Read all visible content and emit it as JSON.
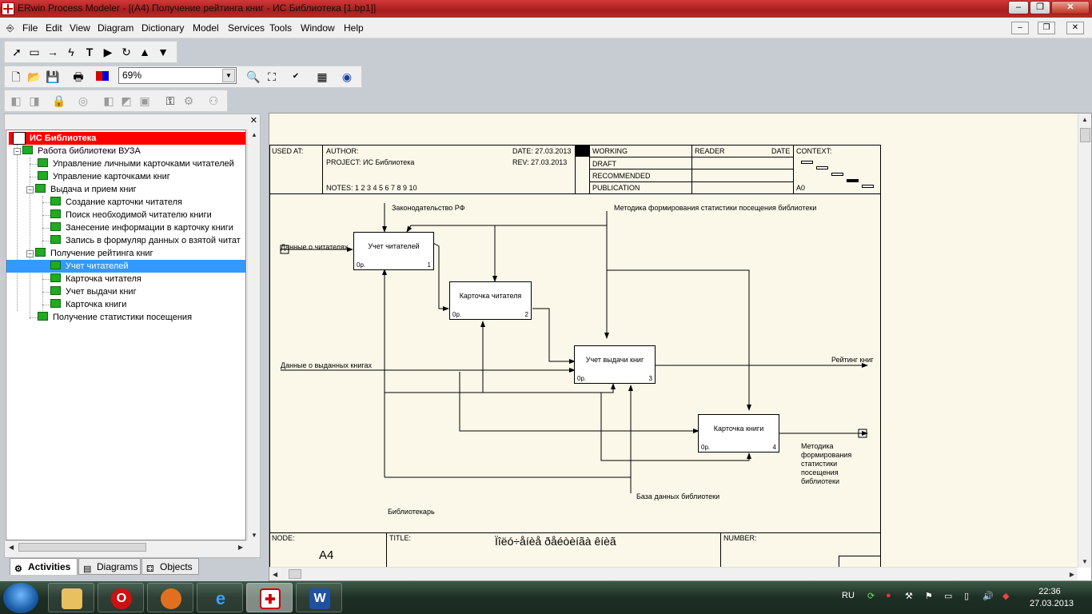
{
  "window": {
    "title": "ERwin Process Modeler - [(A4) Получение рейтинга  книг - ИС Библиотека  [1.bp1]]",
    "min": "–",
    "max": "❐",
    "close": "✕"
  },
  "menu": [
    "File",
    "Edit",
    "View",
    "Diagram",
    "Dictionary",
    "Model",
    "Services",
    "Tools",
    "Window",
    "Help"
  ],
  "zoom": "69%",
  "tree": {
    "root": "ИС Библиотека",
    "items": [
      {
        "label": "Работа библиотеки ВУЗА"
      },
      {
        "label": "Управление личными  карточками читателей"
      },
      {
        "label": "Управление  карточками книг"
      },
      {
        "label": "Выдача и прием книг"
      },
      {
        "label": "Создание карточки  читателя"
      },
      {
        "label": "Поиск необходимой  читателю книги"
      },
      {
        "label": "Занесение информации  в карточку книги"
      },
      {
        "label": "Запись в формуляр  данных о взятой  читат"
      },
      {
        "label": "Получение рейтинга  книг"
      },
      {
        "label": "Учет читателей"
      },
      {
        "label": "Карточка читателя"
      },
      {
        "label": "Учет выдачи книг"
      },
      {
        "label": "Карточка книги"
      },
      {
        "label": "Получение статистики  посещения"
      }
    ]
  },
  "tabs": {
    "activities": "Activities",
    "diagrams": "Diagrams",
    "objects": "Objects"
  },
  "frame": {
    "used_at": "USED AT:",
    "author": "AUTHOR:",
    "project": "PROJECT:  ИС Библиотека",
    "date": "DATE: 27.03.2013",
    "rev": "REV:  27.03.2013",
    "notes": "NOTES:  1  2  3  4  5  6  7  8  9  10",
    "working": "WORKING",
    "draft": "DRAFT",
    "recommended": "RECOMMENDED",
    "publication": "PUBLICATION",
    "reader": "READER",
    "reader_date": "DATE",
    "context": "CONTEXT:",
    "context_node": "A0",
    "node_label": "NODE:",
    "node": "A4",
    "title_label": "TITLE:",
    "title": "Ïîëó÷åíèå ðåéòèíãà  êíèã",
    "number_label": "NUMBER:"
  },
  "boxes": [
    {
      "title": "Учет читателей",
      "cost": "0р.",
      "num": "1"
    },
    {
      "title": "Карточка читателя",
      "cost": "0р.",
      "num": "2"
    },
    {
      "title": "Учет выдачи книг",
      "cost": "0р.",
      "num": "3"
    },
    {
      "title": "Карточка книги",
      "cost": "0р.",
      "num": "4"
    }
  ],
  "arrows": {
    "law": "Законодательство РФ",
    "method": "Методика формирования статистики посещения библиотеки",
    "readers_data": "Данные о читателях",
    "books_data": "Данные о выданных книгах",
    "rating": "Рейтинг книг",
    "method_out": [
      "Методика",
      "формирования",
      "статистики",
      "посещения",
      "библиотеки"
    ],
    "db": "База данных библиотеки",
    "librarian": "Библиотекарь"
  },
  "taskbar": {
    "lang": "RU",
    "time": "22:36",
    "date": "27.03.2013"
  }
}
